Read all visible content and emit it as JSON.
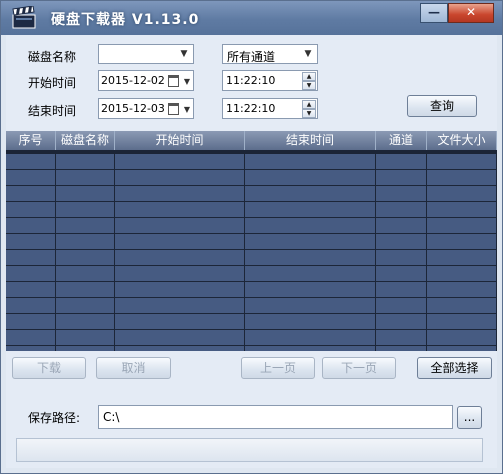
{
  "window": {
    "title": "硬盘下载器 V1.13.0",
    "minimize_label": "—",
    "close_label": "✕"
  },
  "filters": {
    "disk_name_label": "磁盘名称",
    "disk_name_value": "",
    "channel_value": "所有通道",
    "start_time_label": "开始时间",
    "start_date": "2015-12-02",
    "start_time": "11:22:10",
    "end_time_label": "结束时间",
    "end_date": "2015-12-03",
    "end_time": "11:22:10",
    "query_button": "查询"
  },
  "table": {
    "headers": [
      "序号",
      "磁盘名称",
      "开始时间",
      "结束时间",
      "通道",
      "文件大小"
    ],
    "rows": []
  },
  "actions": {
    "download": "下载",
    "cancel": "取消",
    "prev_page": "上一页",
    "next_page": "下一页",
    "select_all": "全部选择"
  },
  "save": {
    "label": "保存路径:",
    "path": "C:\\",
    "browse": "..."
  },
  "colors": {
    "title_bar": "#5f7ba3",
    "grid_background": "#465b82",
    "grid_lines": "#1c2638",
    "client_background": "#e4ebf5"
  },
  "icons": {
    "app": "clapperboard-icon",
    "calendar": "calendar-icon",
    "combo_arrow": "chevron-down-icon"
  }
}
